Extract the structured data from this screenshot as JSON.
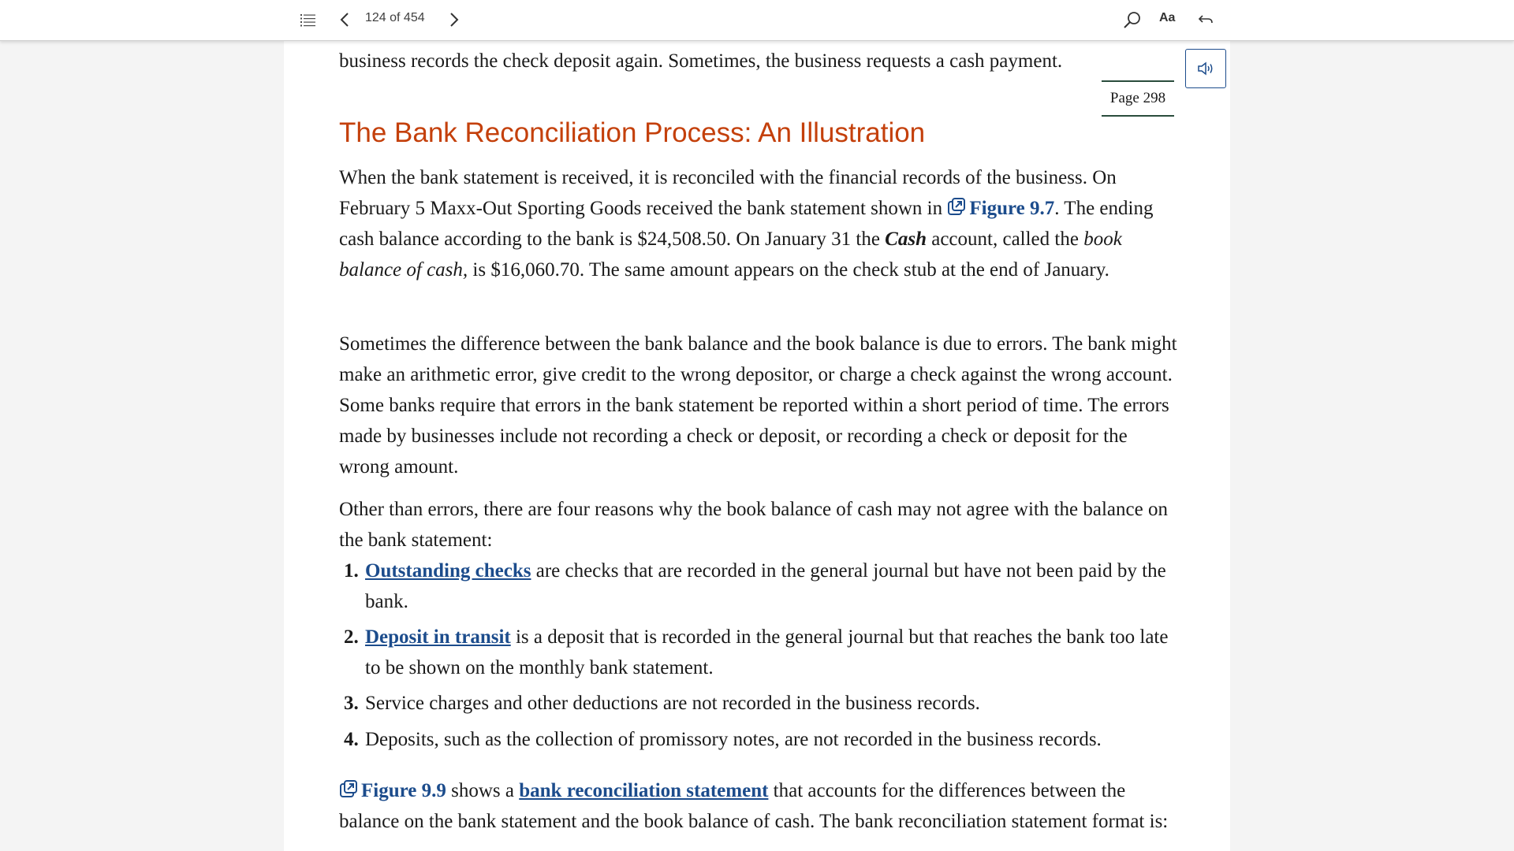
{
  "toolbar": {
    "toc_icon": "list-icon",
    "prev_icon": "chevron-left-icon",
    "page_counter": "124 of 454",
    "next_icon": "chevron-right-icon",
    "search_icon": "search-icon",
    "font_label": "Aa",
    "back_icon": "undo-arrow-icon"
  },
  "audio": {
    "icon": "speaker-icon"
  },
  "content": {
    "top_text": "business records the check deposit again. Sometimes, the business requests a cash payment.",
    "page_marker": "Page 298",
    "heading": "The Bank Reconciliation Process: An Illustration",
    "p1": {
      "a": "When the bank statement is received, it is reconciled with the financial records of the business. On February 5 Maxx-Out Sporting Goods received the bank statement shown in ",
      "link": "Figure 9.7",
      "b": ". The ending cash balance according to the bank is $24,508.50. On January 31 the ",
      "cash": "Cash",
      "c": " account, called the ",
      "book_balance": "book balance of cash,",
      "d": " is $16,060.70. The same amount appears on the check stub at the end of January."
    },
    "p2": "Sometimes the difference between the bank balance and the book balance is due to errors. The bank might make an arithmetic error, give credit to the wrong depositor, or charge a check against the wrong account. Some banks require that errors in the bank statement be reported within a short period of time. The errors made by businesses include not recording a check or deposit, or recording a check or deposit for the wrong amount.",
    "p3": "Other than errors, there are four reasons why the book balance of cash may not agree with the balance on the bank statement:",
    "list": [
      {
        "num": "1.",
        "term": "Outstanding checks",
        "text": " are checks that are recorded in the general journal but have not been paid by the bank."
      },
      {
        "num": "2.",
        "term": "Deposit in transit",
        "text": " is a deposit that is recorded in the general journal but that reaches the bank too late to be shown on the monthly bank statement."
      },
      {
        "num": "3.",
        "text": "Service charges and other deductions are not recorded in the business records."
      },
      {
        "num": "4.",
        "text": "Deposits, such as the collection of promissory notes, are not recorded in the business records."
      }
    ],
    "p4": {
      "link": "Figure 9.9",
      "a": " shows a ",
      "term": "bank reconciliation statement",
      "b": " that accounts for the differences between the balance on the bank statement and the book balance of cash. The bank reconciliation statement format is:"
    }
  },
  "colors": {
    "heading": "#c4400b",
    "link": "#1c4c8c",
    "text": "#1a1a1a"
  }
}
